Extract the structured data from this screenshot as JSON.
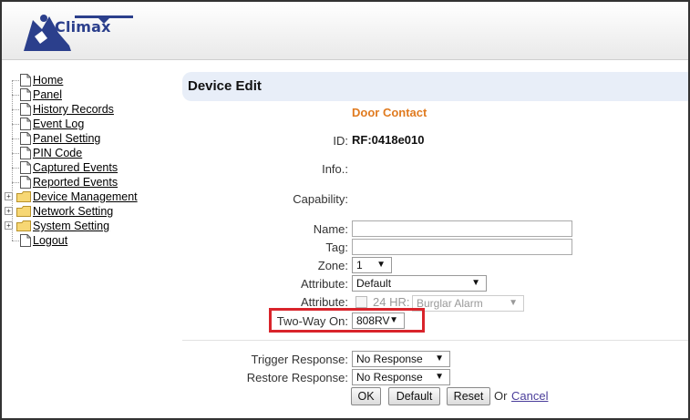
{
  "brand": {
    "name": "Climax"
  },
  "sidebar": {
    "items": [
      {
        "label": "Home",
        "type": "page"
      },
      {
        "label": "Panel",
        "type": "page"
      },
      {
        "label": "History Records",
        "type": "page"
      },
      {
        "label": "Event Log",
        "type": "page"
      },
      {
        "label": "Panel Setting",
        "type": "page"
      },
      {
        "label": "PIN Code",
        "type": "page"
      },
      {
        "label": "Captured Events",
        "type": "page"
      },
      {
        "label": "Reported Events",
        "type": "page"
      },
      {
        "label": "Device Management",
        "type": "folder"
      },
      {
        "label": "Network Setting",
        "type": "folder"
      },
      {
        "label": "System Setting",
        "type": "folder"
      },
      {
        "label": "Logout",
        "type": "page"
      }
    ]
  },
  "page": {
    "title": "Device Edit",
    "device_type": "Door Contact"
  },
  "form": {
    "id_label": "ID:",
    "id_value": "RF:0418e010",
    "info_label": "Info.:",
    "capability_label": "Capability:",
    "name_label": "Name:",
    "name_value": "",
    "tag_label": "Tag:",
    "tag_value": "",
    "zone_label": "Zone:",
    "zone_value": "1",
    "attribute_label": "Attribute:",
    "attribute_value": "Default",
    "attribute2_label": "Attribute:",
    "hr24_label": "24 HR:",
    "hr24_checked": false,
    "hr24_value": "Burglar Alarm",
    "twoway_label": "Two-Way On:",
    "twoway_value": "808RV",
    "trigger_label": "Trigger Response:",
    "trigger_value": "No Response",
    "restore_label": "Restore Response:",
    "restore_value": "No Response"
  },
  "actions": {
    "ok": "OK",
    "default": "Default",
    "reset": "Reset",
    "or": "Or",
    "cancel": "Cancel"
  },
  "colors": {
    "accent_orange": "#e07b20",
    "title_bar_bg": "#e8eef8",
    "highlight_red": "#d9242b",
    "link_purple": "#4a3d9a",
    "logo_blue": "#2b3f8c"
  },
  "icons": {
    "caret": "▼",
    "expander": "+"
  }
}
